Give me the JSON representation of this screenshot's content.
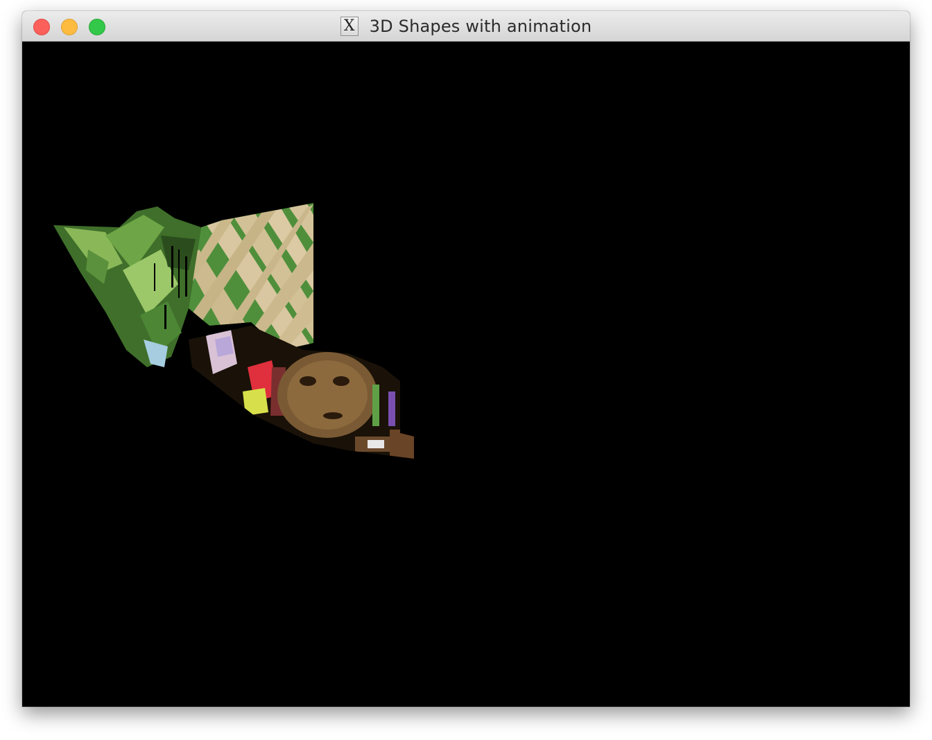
{
  "window": {
    "title": "3D Shapes with animation",
    "app_icon": "x11-icon",
    "app_icon_glyph": "X",
    "controls": [
      "close",
      "minimize",
      "zoom"
    ]
  },
  "colors": {
    "canvas_background": "#000000",
    "close": "#fc605b",
    "minimize": "#fdbc40",
    "zoom": "#34c84a",
    "foliage": "#5e9b3a",
    "lattice": "#d8c7a0",
    "mask": "#7a5a34"
  },
  "scene": {
    "description_icon": "textured-3d-shape"
  }
}
